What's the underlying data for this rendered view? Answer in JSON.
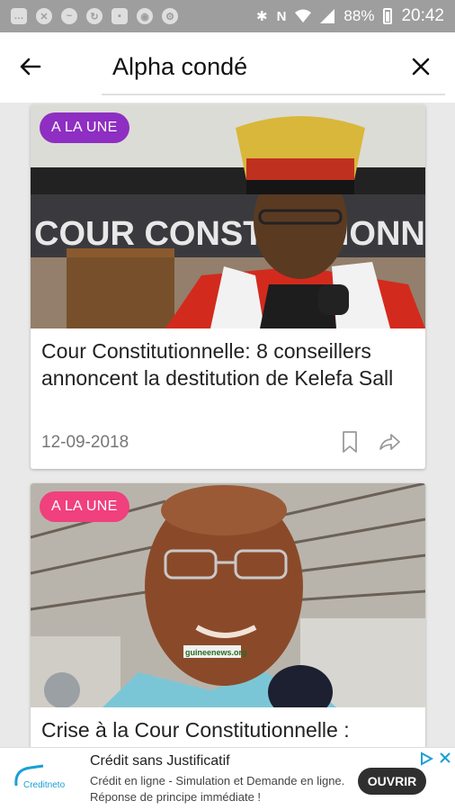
{
  "status_bar": {
    "battery": "88%",
    "time": "20:42",
    "left_icons": [
      "chat-icon",
      "missed-call-icon",
      "messenger-icon",
      "sync-icon",
      "gallery-icon",
      "chrome-icon",
      "settings-icon"
    ],
    "right_icons": [
      "bluetooth-icon",
      "nfc-icon",
      "wifi-icon",
      "signal-icon",
      "battery-icon"
    ]
  },
  "search": {
    "query": "Alpha condé",
    "back_icon": "arrow-left-icon",
    "close_icon": "close-icon"
  },
  "articles": [
    {
      "badge": "A LA UNE",
      "badge_color": "#8e2ec2",
      "title": "Cour Constitutionnelle: 8 conseillers annoncent la destitution de Kelefa Sall",
      "date": "12-09-2018",
      "photo_sign_text": "COUR CONSTITUTIONNELLE"
    },
    {
      "badge": "A LA UNE",
      "badge_color": "#f0407d",
      "title": "Crise à la Cour Constitutionnelle :",
      "watermark": "guineenews.org"
    }
  ],
  "ad": {
    "title": "Crédit sans Justificatif",
    "description": "Crédit en ligne - Simulation et Demande en ligne. Réponse de principe immédiate !",
    "button": "OUVRIR",
    "logo_text": "Creditneto",
    "accent": "#1a9fd6"
  }
}
